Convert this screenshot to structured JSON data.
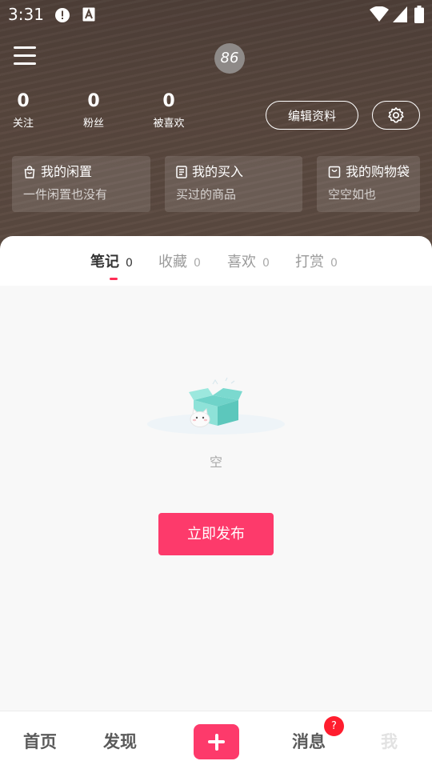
{
  "status_bar": {
    "time": "3:31"
  },
  "profile": {
    "avatar_text": "86",
    "stats": [
      {
        "value": "0",
        "label": "关注"
      },
      {
        "value": "0",
        "label": "粉丝"
      },
      {
        "value": "0",
        "label": "被喜欢"
      }
    ],
    "edit_label": "编辑资料"
  },
  "cards": [
    {
      "icon": "bag-icon",
      "title": "我的闲置",
      "subtitle": "一件闲置也没有"
    },
    {
      "icon": "receipt-icon",
      "title": "我的买入",
      "subtitle": "买过的商品"
    },
    {
      "icon": "shopping-bag-icon",
      "title": "我的购物袋",
      "subtitle": "空空如也"
    }
  ],
  "tabs": [
    {
      "label": "笔记",
      "count": "0",
      "active": true
    },
    {
      "label": "收藏",
      "count": "0"
    },
    {
      "label": "喜欢",
      "count": "0"
    },
    {
      "label": "打赏",
      "count": "0"
    }
  ],
  "empty": {
    "text": "空",
    "button": "立即发布"
  },
  "tabbar": {
    "home": "首页",
    "discover": "发现",
    "messages": "消息",
    "messages_badge": "?",
    "me": "我"
  },
  "colors": {
    "accent": "#fd3a6b",
    "header_bg": "#54443c",
    "badge": "#ff1d2e"
  }
}
